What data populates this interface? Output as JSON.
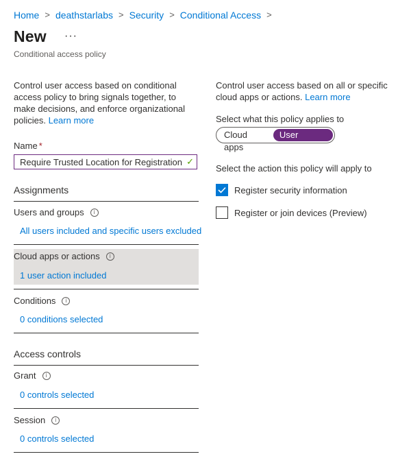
{
  "breadcrumb": [
    "Home",
    "deathstarlabs",
    "Security",
    "Conditional Access"
  ],
  "header": {
    "title": "New",
    "more": "···",
    "subtitle": "Conditional access policy"
  },
  "left": {
    "intro": "Control user access based on conditional access policy to bring signals together, to make decisions, and enforce organizational policies.",
    "intro_link": "Learn more",
    "name_label": "Name",
    "name_required": "*",
    "name_value": "Require Trusted Location for Registration",
    "assignments": "Assignments",
    "users_label": "Users and groups",
    "users_value": "All users included and specific users excluded",
    "cloud_label": "Cloud apps or actions",
    "cloud_value": "1 user action included",
    "conditions_label": "Conditions",
    "conditions_value": "0 conditions selected",
    "access_controls": "Access controls",
    "grant_label": "Grant",
    "grant_value": "0 controls selected",
    "session_label": "Session",
    "session_value": "0 controls selected"
  },
  "right": {
    "intro": "Control user access based on all or specific cloud apps or actions.",
    "intro_link": "Learn more",
    "applies_label": "Select what this policy applies to",
    "toggle": [
      "Cloud apps",
      "User actions"
    ],
    "toggle_selected": "User actions",
    "action_label": "Select the action this policy will apply to",
    "options": [
      {
        "label": "Register security information",
        "checked": true
      },
      {
        "label": "Register or join devices (Preview)",
        "checked": false
      }
    ]
  },
  "icons": {
    "info": "info-icon",
    "check": "checkmark-icon",
    "chevron": "chevron-right-icon"
  },
  "colors": {
    "link": "#0078d4",
    "accent": "#6b2a7f",
    "checkbox": "#0078d4",
    "selected_bg": "#e1dfdd"
  }
}
